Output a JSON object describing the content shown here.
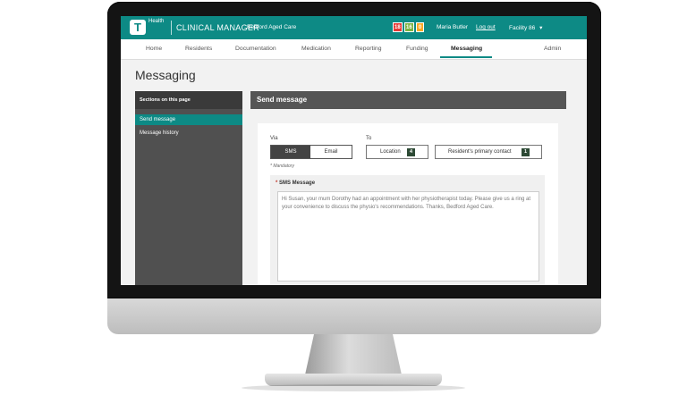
{
  "app": {
    "brand_word": "Health",
    "brand_letter": "T",
    "title": "CLINICAL MANAGER",
    "facility_name": "Bedford Aged Care"
  },
  "header": {
    "badges": [
      {
        "value": "18",
        "color": "#e53935"
      },
      {
        "value": "16",
        "color": "#7cb342"
      },
      {
        "value": "0",
        "color": "#f9a825"
      }
    ],
    "user_name": "Maria Butler",
    "logout_label": "Log out",
    "facility_select": "Facility 86",
    "chevron": "▾"
  },
  "nav": {
    "items": [
      "Home",
      "Residents",
      "Documentation",
      "Medication",
      "Reporting",
      "Funding",
      "Messaging",
      "Admin"
    ],
    "active": "Messaging"
  },
  "page": {
    "title": "Messaging"
  },
  "sidebar": {
    "title": "Sections on this page",
    "items": [
      "Send message",
      "Message history"
    ],
    "active": "Send message"
  },
  "panel": {
    "title": "Send message",
    "via_label": "Via",
    "via_options": [
      "SMS",
      "Email"
    ],
    "via_selected": "SMS",
    "to_label": "To",
    "to_location": {
      "label": "Location",
      "count": "4"
    },
    "to_contact": {
      "label": "Resident's primary contact",
      "count": "1"
    },
    "mandatory_note": "* Mandatory",
    "sms_label": "SMS Message",
    "sms_text": "Hi Susan, your mum Dorothy had an appointment with her physiotherapist today. Please give us a ring at your convenience to discuss the physio's recommendations. Thanks, Bedford Aged Care."
  },
  "colors": {
    "brand": "#0d8a85",
    "sidebar": "#505050",
    "badge_dark": "#2d4a35"
  }
}
